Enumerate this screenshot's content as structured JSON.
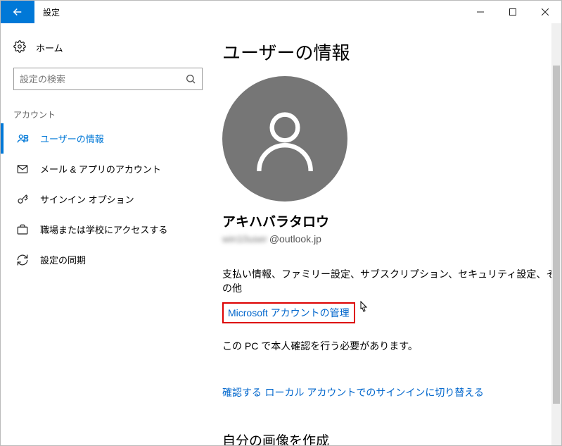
{
  "window": {
    "title": "設定"
  },
  "sidebar": {
    "home": "ホーム",
    "searchPlaceholder": "設定の検索",
    "section": "アカウント",
    "items": [
      {
        "label": "ユーザーの情報"
      },
      {
        "label": "メール & アプリのアカウント"
      },
      {
        "label": "サインイン オプション"
      },
      {
        "label": "職場または学校にアクセスする"
      },
      {
        "label": "設定の同期"
      }
    ]
  },
  "content": {
    "pageTitle": "ユーザーの情報",
    "userName": "アキハバラタロウ",
    "emailLocalMasked": "win10user",
    "emailDomain": "@outlook.jp",
    "accountDesc": "支払い情報、ファミリー設定、サブスクリプション、セキュリティ設定、その他",
    "manageLink": "Microsoft アカウントの管理",
    "verifyNote": "この PC で本人確認を行う必要があります。",
    "verifyLink": "確認する",
    "localLink": "ローカル アカウントでのサインインに切り替える",
    "pictureHeading": "自分の画像を作成"
  }
}
